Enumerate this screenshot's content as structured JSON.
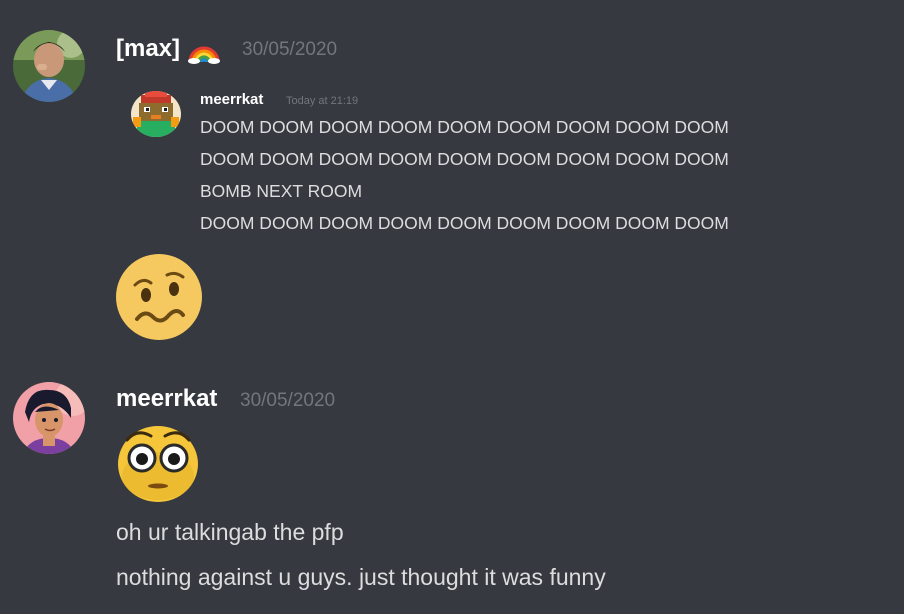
{
  "messages": [
    {
      "username": "[max]",
      "username_emoji": "rainbow-emoji",
      "timestamp": "30/05/2020",
      "avatar_icon": "user-avatar-photo",
      "quote": {
        "author": "meerrkat",
        "time": "Today at 21:19",
        "avatar_icon": "pixel-art-avatar",
        "lines": [
          "DOOM DOOM DOOM DOOM DOOM DOOM DOOM DOOM DOOM",
          "DOOM DOOM DOOM DOOM DOOM DOOM DOOM DOOM DOOM",
          "BOMB NEXT ROOM",
          "DOOM DOOM DOOM DOOM DOOM DOOM DOOM DOOM DOOM"
        ]
      },
      "emoji": "woozy-face-emoji"
    },
    {
      "username": "meerrkat",
      "timestamp": "30/05/2020",
      "avatar_icon": "cartoon-avatar",
      "emoji": "flushed-face-emoji",
      "lines": [
        "oh ur talkingab the pfp",
        "nothing against u guys. just thought it was funny"
      ]
    }
  ],
  "colors": {
    "background": "#36393f",
    "text": "#dcddde",
    "username": "#ffffff",
    "timestamp": "#72767d"
  }
}
